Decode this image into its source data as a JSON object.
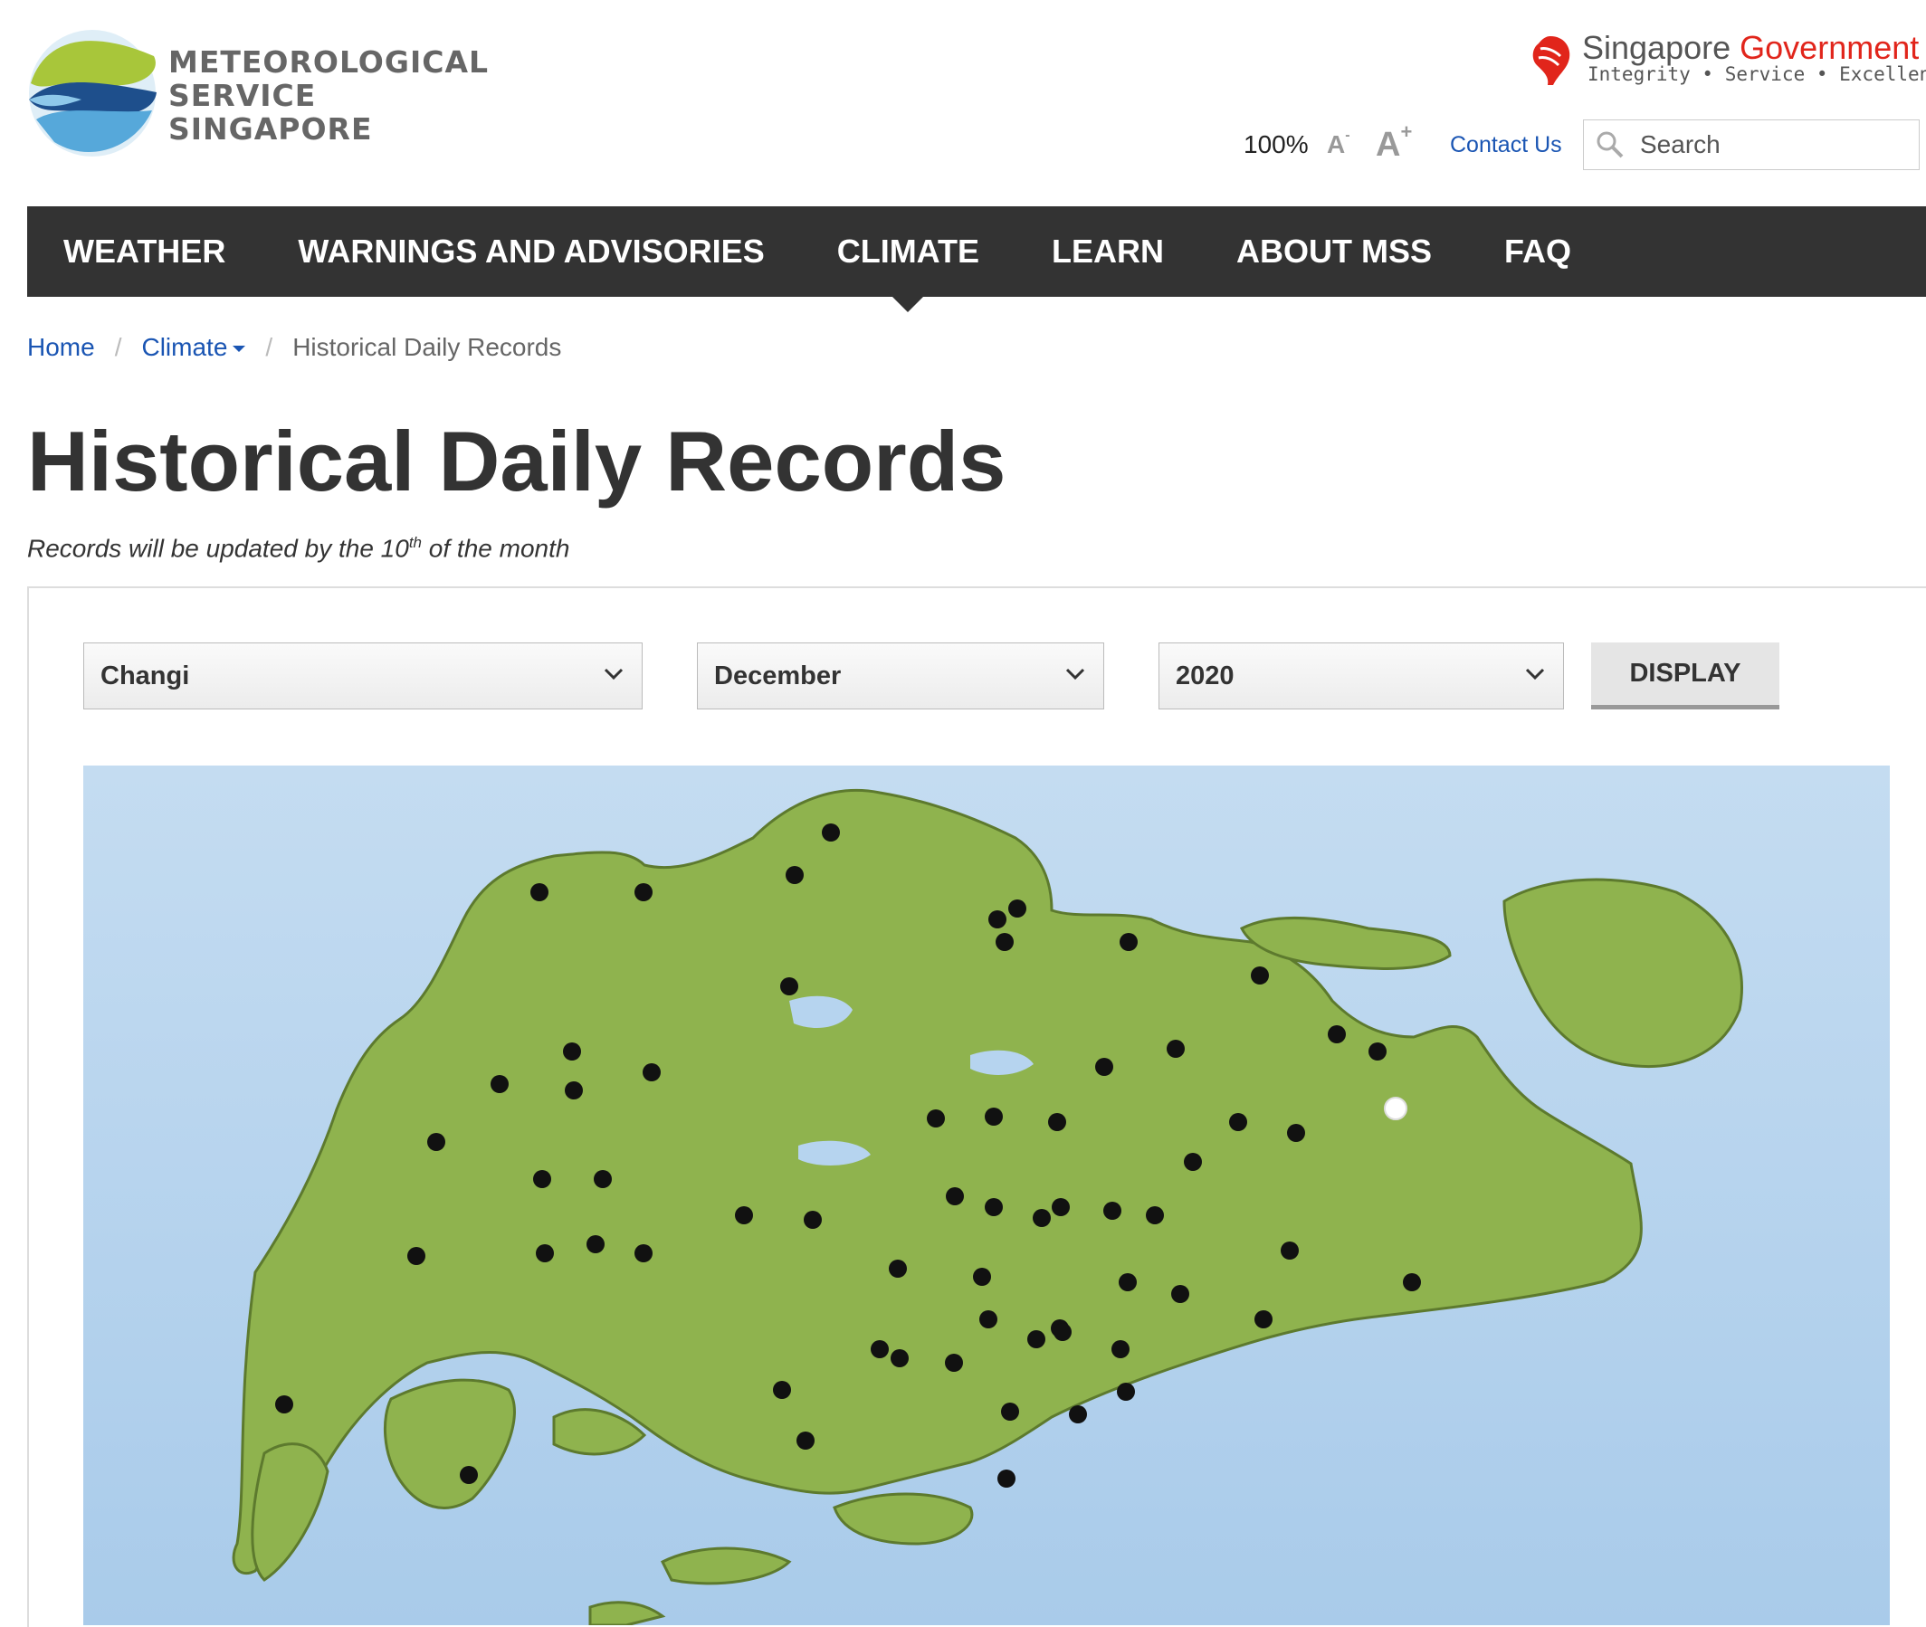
{
  "header": {
    "logo_lines": [
      "Meteorological",
      "Service",
      "Singapore"
    ],
    "gov_name_1": "Singapore",
    "gov_name_2": "Government",
    "gov_tagline": "Integrity • Service • Excellence",
    "zoom_level": "100%",
    "font_decrease": "A",
    "font_increase": "A",
    "contact_label": "Contact Us",
    "search_placeholder": "Search"
  },
  "nav": {
    "items": [
      "WEATHER",
      "WARNINGS AND ADVISORIES",
      "CLIMATE",
      "LEARN",
      "ABOUT MSS",
      "FAQ"
    ],
    "active": "CLIMATE"
  },
  "breadcrumb": {
    "home": "Home",
    "climate": "Climate",
    "current": "Historical Daily Records"
  },
  "page": {
    "title": "Historical Daily Records",
    "note_before": "Records will be updated by the 10",
    "note_sup": "th",
    "note_after": " of the month"
  },
  "form": {
    "station": "Changi",
    "month": "December",
    "year": "2020",
    "display_label": "DISPLAY"
  },
  "colors": {
    "nav_bg": "#333333",
    "link": "#1a55b3",
    "land": "#8fb34e",
    "sea": "#b6d4ef",
    "gov_red": "#e1251b"
  }
}
